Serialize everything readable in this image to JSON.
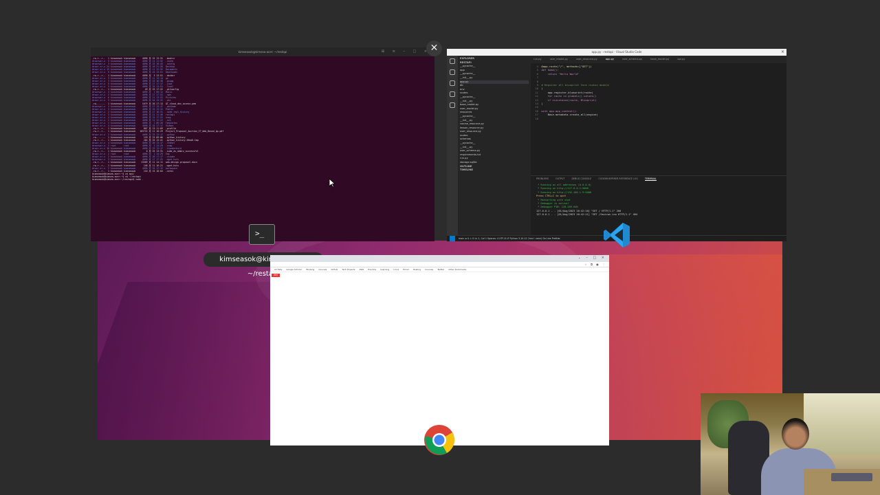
{
  "tooltip": {
    "text": "kimseasok@kimsea-acer: ~/restapi"
  },
  "close_button": {
    "label": "✕"
  },
  "terminal_icon": {
    "glyph": ">_"
  },
  "terminal": {
    "title": "kimseasok@kimsea-acer: ~/restapi",
    "lines": [
      "-rw-r--r--  1 kimseasok kimseasok     4096 月 25 13:31  .bashrc",
      "drwxrwxr-x  3 kimseasok kimseasok     4096 月 11 11:32  .cache",
      "drwxrwxr-x  3 kimseasok kimseasok     4096 月 23 10:43  .config",
      "drwxr-xr-x 24 kimseasok kimseasok     4096 月 16 21:35  Desktop",
      "drwxr-xr-x 13 kimseasok kimseasok     4096 月 11 12:32  Documents",
      "drwxr-xr-x  9 kimseasok kimseasok     4096 月 24 13:51  Downloads",
      "-rw-r--r--  1 kimseasok kimseasok     4096 月  3 13:51  .docker",
      "drwxr-xr-x  3 kimseasok kimseasok     4096 月 11 13:14  go",
      "drwxr-xr-x  3 kimseasok kimseasok     4096 月 23 18:38  .gnupg",
      "drwxr-xr-x  5 kimseasok kimseasok     4096 月 17 17:17  .java",
      "drwxr-xr-x  3 kimseasok kimseasok     4096 月 25 13:51  .local",
      "-rw-r--r--  1 kimseasok kimseasok       49 月 25 17:22  .gitconfig",
      "drwxrwxr-x  4 kimseasok kimseasok     4096 月  1 09:11  Music",
      "drwxr-xr-x  2 kimseasok kimseasok     4096 月 17 17:31  .npm",
      "drwxrwxr-x  6 kimseasok kimseasok     4096 月 11 13:31  Pictures",
      "drwxr-xr-x  3 kimseasok kimseasok     4096 月 24 13:31  .pki",
      "-rw-------  1 kimseasok kimseasok     1679 月 20 17:13  AT_cloud_dev_access.pem",
      "drwxrwxr-x  3 kimseasok kimseasok     4096 月 17 13:17  .postman",
      "drwxr-xr-x  3 kimseasok kimseasok     4096 月 25 13:11  Public",
      "drwxrwxr-x  2 kimseasok kimseasok     4096 月 17 16:31  .node_repl_history",
      "drwxr-xr-x  3 kimseasok kimseasok     4096 月 11 11:36  restapi",
      "drwxr-xr-x  4 kimseasok kimseasok     4096 月 21 17:31  snap",
      "drwxr-xr-x  2 kimseasok kimseasok     4096 月 11 12:22  .ssh",
      "drwxr-xr-x  2 kimseasok kimseasok     4096 月  1 09:26  Templates",
      "drwxr-xr-x  4 kimseasok kimseasok     4096 月 25 17:17  Videos",
      "-rw-r--r--  1 kimseasok kimseasok      807 月 13 11:09  .profile",
      "-rw-r--r--  1 kimseasok kimseasok   183722 月 11 10:29  Project_Proposal_Auction_IT_Web_Based_bp.pdf",
      "drwxr-xr-x  2 kimseasok kimseasok     4096 月 23 13:17  .python",
      "-rw-------  1 kimseasok kimseasok      129 月 23 09:06  .python_history",
      "-rw-r--r--  1 kimseasok kimseasok      264 月 25 13:41  .python_history-56ea6.tmp",
      "drwxr-xr-x  4 kimseasok kimseasok     4096 月 26 13:17  .redhat",
      "drwxrwxr-x  2 root      root          4096 月  1 14:29  .snap",
      "drwxr-xr-x 10 kimseasok kimseasok     4096 月 23 13:17  .thunderbird",
      "-rw-r--r--  1 kimseasok kimseasok        0 月 25 13:31  .sudo_as_admin_successful",
      "drwxr-xr-x  2 root      root          4096 月  1 14:29  tmp",
      "drwxr-xr-x  2 kimseasok kimseasok     4096 月 26 17:17  .vscode",
      "drwxrwxr-x  3 kimseasok kimseasok     4096 月 17 17:31  .wget-hsts",
      "-rw-r--r--  1 kimseasok kimseasok    13509 月 11 14:11  web-design-proposal.docx",
      "-rw-r--r--  1 kimseasok kimseasok      146 月 11 16:21  .wget-hsts",
      "drwxr-xr-x  2 kimseasok kimseasok     4096 月 25 17:12  workspace",
      "-rw-r--r--  1 kimseasok kimseasok      116 月 15 18:04  .zshrc",
      "kimseasok@kimsea-acer:~$ cd api/",
      "kimseasok@kimsea-acer:~$ cd ~/restapi",
      "kimseasok@kimsea-acer:~/restapi$ code ."
    ]
  },
  "vscode": {
    "title": "app.py - restapi - Visual Studio Code",
    "explorer_header": "EXPLORER",
    "project": "RESTAPI",
    "tree": [
      "__pycache__",
      "app",
      "__pycache__",
      "__init__.py",
      "app.py",
      "db",
      "env",
      "routes",
      "__pycache__",
      "__init__.py",
      "base_model.py",
      "user_model.py",
      "resources",
      "__pycache__",
      "__init__.py",
      "course_resource.py",
      "lesson_resource.py",
      "user_resource.py",
      "routes",
      "schemas",
      "__pycache__",
      "__init__.py",
      "user_schema.py",
      "requirements.txt",
      "run.py",
      "storage.sqlite"
    ],
    "outline": "OUTLINE",
    "timeline": "TIMELINE",
    "tabs": [
      "run.py",
      "user_model.py",
      "user_resource.py",
      "app.py",
      "user_schema.py",
      "base_model.py",
      "api.py"
    ],
    "code": [
      {
        "n": "4",
        "t": "@app.route(\"/\", methods=[\"GET\"])"
      },
      {
        "n": "5",
        "t": "def home():"
      },
      {
        "n": "6",
        "t": "    return \"Hello World\""
      },
      {
        "n": "7",
        "t": ""
      },
      {
        "n": "8",
        "t": ""
      },
      {
        "n": "9",
        "t": "# Register all blueprint form routes module"
      },
      {
        "n": "10",
        "t": "("
      },
      {
        "n": "11",
        "t": "    app.register_blueprint(route)"
      },
      {
        "n": "12",
        "t": "    for route in globals().values()"
      },
      {
        "n": "13",
        "t": "    if isinstance(route, Blueprint)"
      },
      {
        "n": "14",
        "t": ")"
      },
      {
        "n": "15",
        "t": ""
      },
      {
        "n": "16",
        "t": "with app.app_context():"
      },
      {
        "n": "17",
        "t": "    Base.metadata.create_all(engine)"
      },
      {
        "n": "18",
        "t": ""
      }
    ],
    "panel_tabs": [
      "PROBLEMS",
      "OUTPUT",
      "DEBUG CONSOLE",
      "CODEWHISPERER REFERENCE LOG",
      "TERMINAL"
    ],
    "terminal_lines": [
      " * Running on all addresses (0.0.0.0)",
      " * Running on http://127.0.0.1:5000",
      " * Running on http://192.168.1.9:5000",
      "Press CTRL+C to quit",
      " * Restarting with stat",
      " * Debugger is active!",
      " * Debugger PIN: 120-489-648",
      "127.0.0.1 - - [01/Aug/2023 16:42:10] \"GET / HTTP/1.1\" 200",
      "127.0.0.1 - - [01/Aug/2023 16:42:11] \"GET /favicon.ico HTTP/1.1\" 404"
    ],
    "status": "main  ⊗ 0 ⚠ 0   Ln 1, Col 1   Spaces: 4   UTF-8   LF   Python 3.10.12 ('env': venv)   Go Live   Prettier"
  },
  "chrome": {
    "bookmarks": [
      "All Tabs",
      "Google Scholar",
      "Working",
      "Courses",
      "Github",
      "Tech Experts",
      "AWS",
      "Practice",
      "Learning",
      "Linux",
      "Email",
      "Hosting",
      "Courses",
      "Twitter",
      "Other bookmarks"
    ],
    "page_badge": "404"
  },
  "colors": {
    "terminal_bg": "#300a24",
    "vscode_bg": "#1e1e1e",
    "vscode_accent": "#007acc",
    "wallpaper_start": "#5a1a55",
    "wallpaper_end": "#d3503e"
  }
}
